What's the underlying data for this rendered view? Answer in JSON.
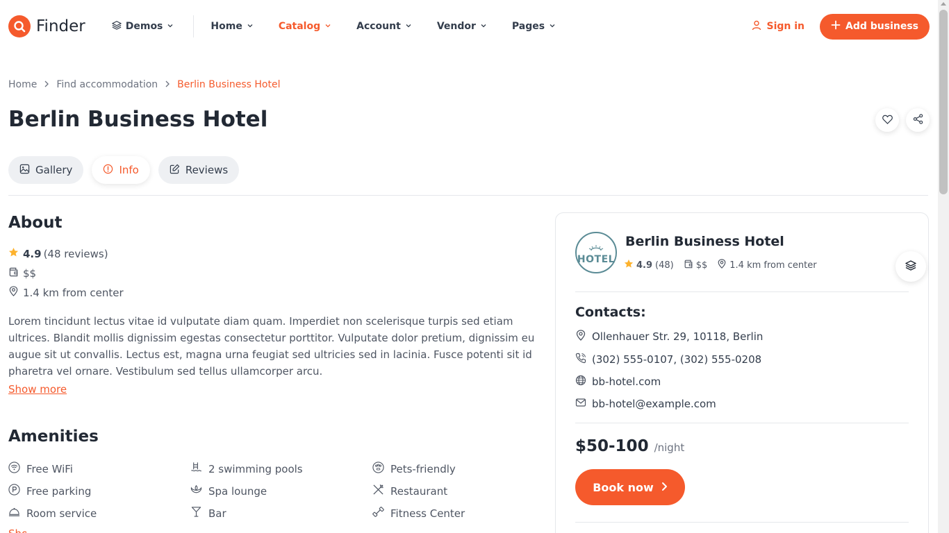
{
  "nav": {
    "brand": "Finder",
    "items": [
      {
        "label": "Demos"
      },
      {
        "label": "Home"
      },
      {
        "label": "Catalog"
      },
      {
        "label": "Account"
      },
      {
        "label": "Vendor"
      },
      {
        "label": "Pages"
      }
    ],
    "active_item": "Catalog",
    "signin": "Sign in",
    "add_business": "Add business"
  },
  "breadcrumb": [
    "Home",
    "Find accommodation",
    "Berlin Business Hotel"
  ],
  "page_title": "Berlin Business Hotel",
  "tabs": [
    {
      "label": "Gallery",
      "icon": "image-icon"
    },
    {
      "label": "Info",
      "icon": "info-icon"
    },
    {
      "label": "Reviews",
      "icon": "edit-icon"
    }
  ],
  "active_tab": "Info",
  "about": {
    "title": "About",
    "rating": "4.9",
    "reviews": "(48 reviews)",
    "price_level": "$$",
    "distance": "1.4 km from center",
    "description": "Lorem tincidunt lectus vitae id vulputate diam quam. Imperdiet non scelerisque turpis sed etiam ultrices. Blandit mollis dignissim egestas consectetur porttitor. Vulputate dolor pretium, dignissim eu augue sit ut convallis. Lectus est, magna urna feugiat sed ultricies sed in lacinia. Fusce potenti sit id pharetra vel ornare. Vestibulum sed tellus ullamcorper arcu.",
    "show_more": "Show more"
  },
  "amenities": {
    "title": "Amenities",
    "items": [
      {
        "label": "Free WiFi",
        "icon": "wifi-icon"
      },
      {
        "label": "2 swimming pools",
        "icon": "pool-icon"
      },
      {
        "label": "Pets-friendly",
        "icon": "paw-icon"
      },
      {
        "label": "Free parking",
        "icon": "parking-icon"
      },
      {
        "label": "Spa lounge",
        "icon": "spa-icon"
      },
      {
        "label": "Restaurant",
        "icon": "cutlery-icon"
      },
      {
        "label": "Room service",
        "icon": "cloche-icon"
      },
      {
        "label": "Bar",
        "icon": "cocktail-icon"
      },
      {
        "label": "Fitness Center",
        "icon": "dumbbell-icon"
      }
    ]
  },
  "card": {
    "logo_text": "HOTEL",
    "name": "Berlin Business Hotel",
    "rating": "4.9",
    "reviews": "(48)",
    "price_level": "$$",
    "distance": "1.4 km from center",
    "contacts_title": "Contacts:",
    "address": "Ollenhauer Str. 29, 10118, Berlin",
    "phone": "(302) 555-0107, (302) 555-0208",
    "website": "bb-hotel.com",
    "email": "bb-hotel@example.com",
    "price": "$50-100",
    "price_unit": "/night",
    "book": "Book now"
  },
  "colors": {
    "accent": "#f55a2c",
    "text": "#222934",
    "muted": "#6c727f",
    "star": "#fdb22d"
  }
}
